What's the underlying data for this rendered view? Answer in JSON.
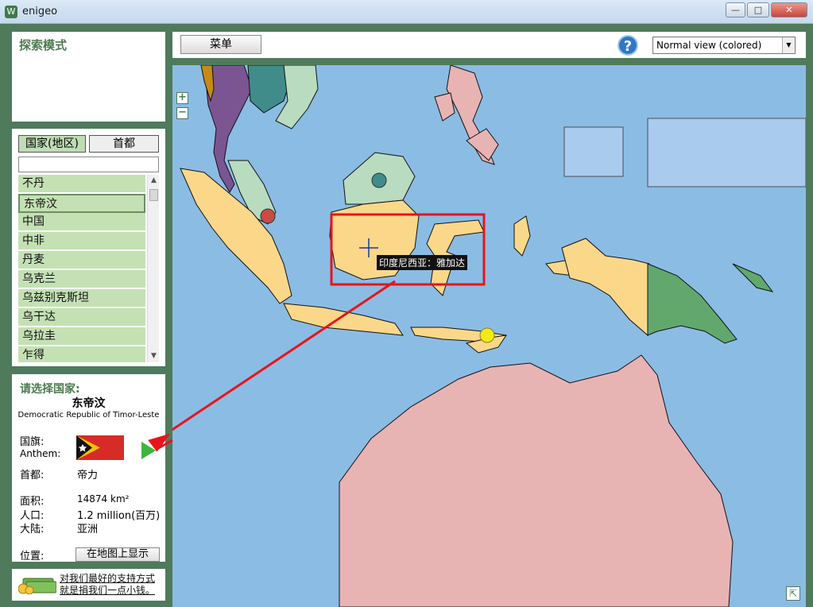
{
  "window": {
    "title": "enigeo",
    "app_icon": "W",
    "minimize": "—",
    "maximize": "□",
    "close": "✕"
  },
  "mode": {
    "label": "探索模式"
  },
  "tabs": {
    "countries": "国家(地区)",
    "capitals": "首都"
  },
  "search": {
    "value": "",
    "placeholder": ""
  },
  "list": {
    "items": [
      "不丹",
      "东帝汶",
      "中国",
      "中非",
      "丹麦",
      "乌克兰",
      "乌兹别克斯坦",
      "乌干达",
      "乌拉圭",
      "乍得"
    ],
    "selected_index": 1,
    "scroll_up": "▲",
    "scroll_down": "▼"
  },
  "info": {
    "heading": "请选择国家:",
    "country_name": "东帝汶",
    "official_name": "Democratic Republic of Timor-Leste",
    "flag_label": "国旗:",
    "anthem_label": "Anthem:",
    "capital_label": "首都:",
    "capital_value": "帝力",
    "area_label": "面积:",
    "area_value": "14874 km²",
    "population_label": "人口:",
    "population_value": "1.2 million(百万)",
    "continent_label": "大陆:",
    "continent_value": "亚洲",
    "location_label": "位置:",
    "show_on_map": "在地图上显示"
  },
  "donate": {
    "line1": "对我们最好的支持方式",
    "line2": "就是捐我们一点小钱。"
  },
  "toolbar": {
    "menu": "菜单",
    "help": "?",
    "view_option": "Normal view (colored)",
    "view_arrow": "▼"
  },
  "map": {
    "tooltip": "印度尼西亚：雅加达",
    "zoom_in": "+",
    "zoom_out": "−",
    "expand": "⇱",
    "colors": {
      "sea": "#8bbce4",
      "indonesia": "#fbd78a",
      "australia": "#e8b3b3",
      "malaysia": "#b9dbc0",
      "papua": "#62a86d",
      "thailand": "#7b5591",
      "philippines": "#e8b3b3",
      "annotation": "#e8141a"
    }
  }
}
